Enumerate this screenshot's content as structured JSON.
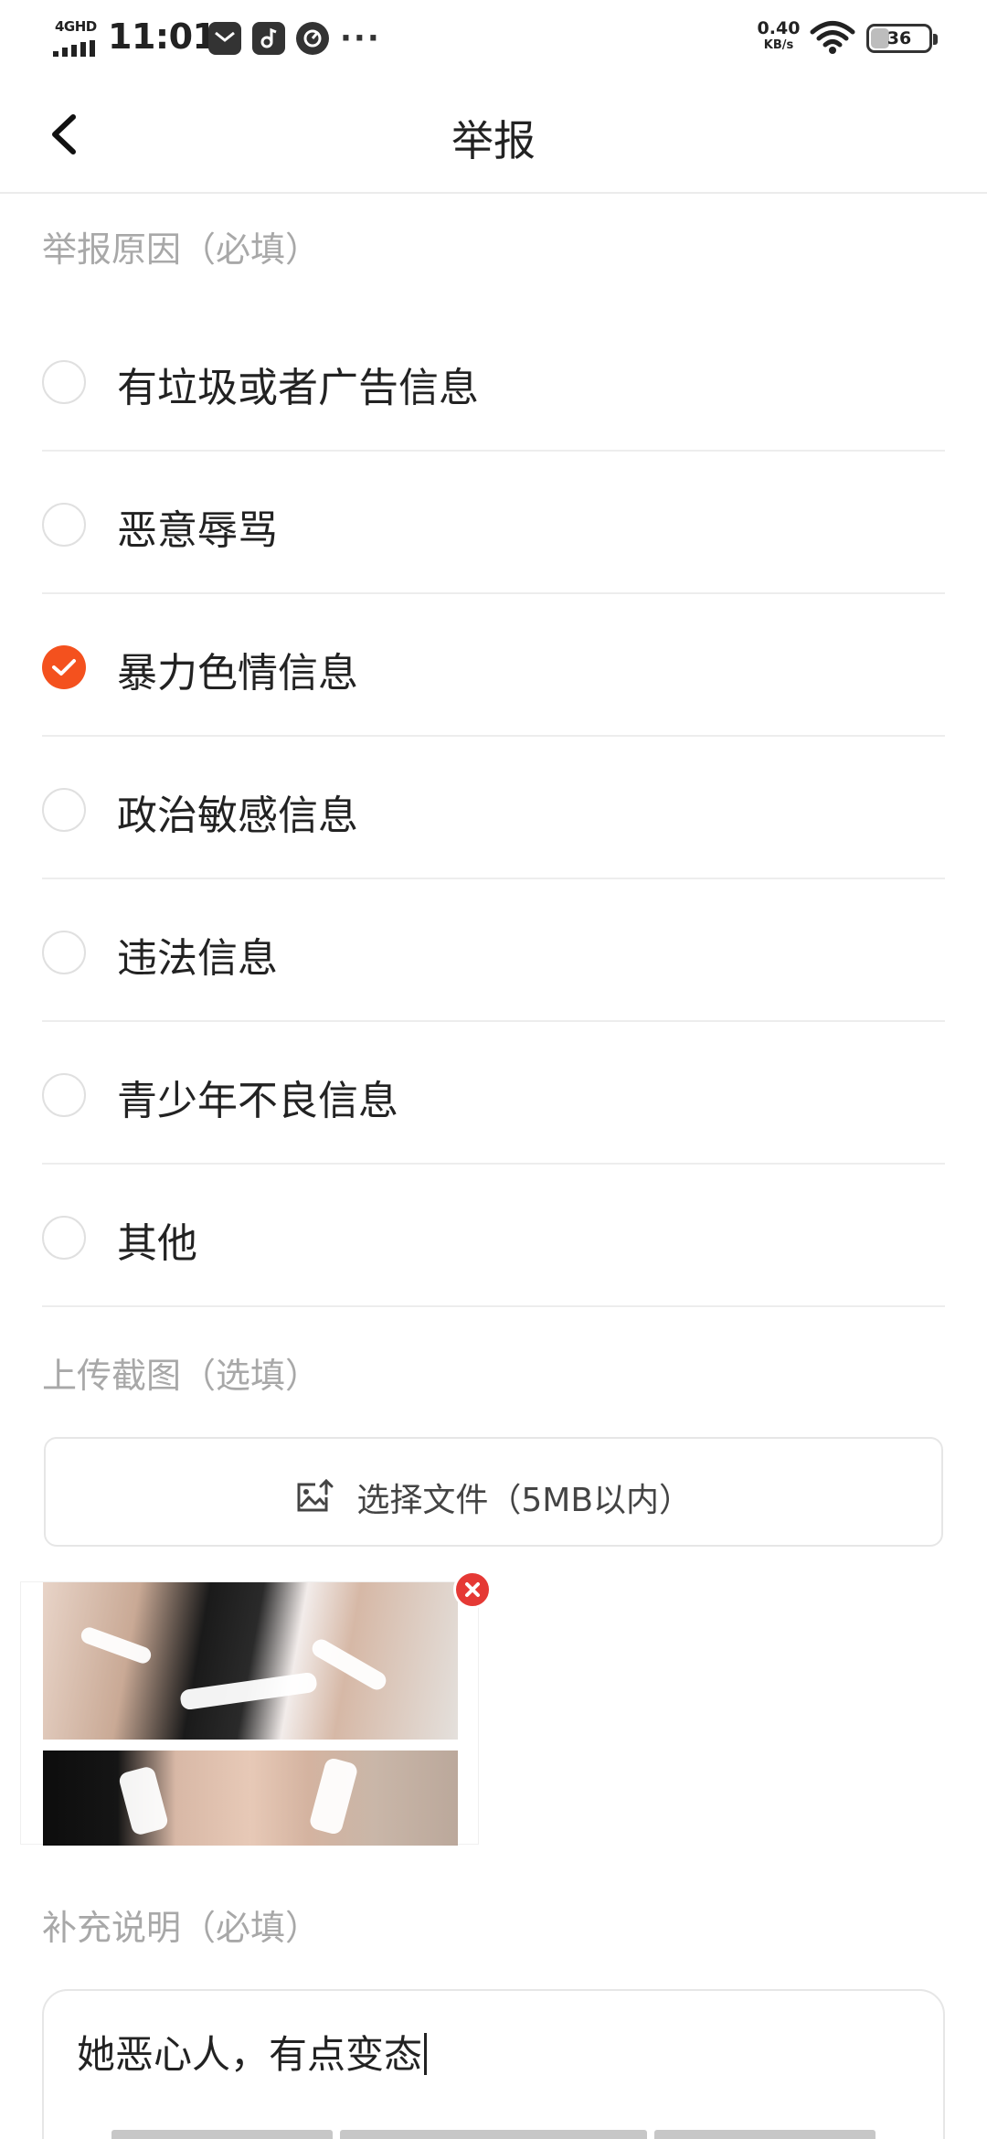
{
  "status_bar": {
    "network": "4GHD",
    "time": "11:01",
    "more": "···",
    "speed_value": "0.40",
    "speed_unit": "KB/s",
    "battery_level": "36",
    "battery_fraction": 0.36
  },
  "header": {
    "title": "举报",
    "back_icon": "chevron-left-icon"
  },
  "reasons": {
    "section_label": "举报原因（必填）",
    "items": [
      {
        "label": "有垃圾或者广告信息",
        "checked": false
      },
      {
        "label": "恶意辱骂",
        "checked": false
      },
      {
        "label": "暴力色情信息",
        "checked": true
      },
      {
        "label": "政治敏感信息",
        "checked": false
      },
      {
        "label": "违法信息",
        "checked": false
      },
      {
        "label": "青少年不良信息",
        "checked": false
      },
      {
        "label": "其他",
        "checked": false
      }
    ],
    "accent_color": "#f4511e"
  },
  "upload": {
    "section_label": "上传截图（选填）",
    "button_label": "选择文件（5MB以内）",
    "button_icon": "image-upload-icon",
    "remove_icon": "close-icon"
  },
  "description": {
    "section_label": "补充说明（必填）",
    "value": "她恶心人，有点变态"
  }
}
